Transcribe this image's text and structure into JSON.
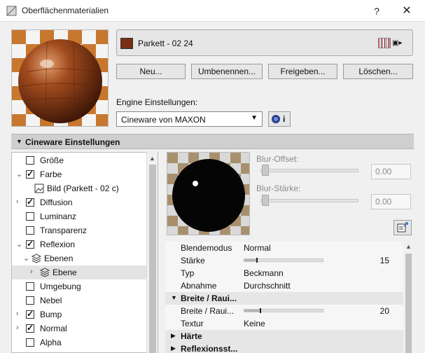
{
  "window": {
    "title": "Oberflächenmaterialien",
    "help_label": "?",
    "close_label": "✕"
  },
  "material": {
    "name": "Parkett - 02 24",
    "swatch_color": "#7a2e14",
    "extra_label": "▣▸"
  },
  "actions": {
    "new_label": "Neu...",
    "rename_label": "Umbenennen...",
    "share_label": "Freigeben...",
    "delete_label": "Löschen..."
  },
  "engine": {
    "label": "Engine Einstellungen:",
    "selected": "Cineware von MAXON",
    "info_label": "i"
  },
  "section": {
    "title": "Cineware Einstellungen"
  },
  "channels": [
    {
      "label": "Größe"
    },
    {
      "label": "Farbe"
    },
    {
      "label": "Bild (Parkett - 02 c)"
    },
    {
      "label": "Diffusion"
    },
    {
      "label": "Luminanz"
    },
    {
      "label": "Transparenz"
    },
    {
      "label": "Reflexion"
    },
    {
      "label": "Ebenen"
    },
    {
      "label": "Ebene"
    },
    {
      "label": "Umgebung"
    },
    {
      "label": "Nebel"
    },
    {
      "label": "Bump"
    },
    {
      "label": "Normal"
    },
    {
      "label": "Alpha"
    }
  ],
  "blur": {
    "offset_label": "Blur-Offset:",
    "offset_value": "0.00",
    "strength_label": "Blur-Stärke:",
    "strength_value": "0.00"
  },
  "properties": {
    "blend_mode": {
      "key": "Blendemodus",
      "value": "Normal"
    },
    "strength": {
      "key": "Stärke",
      "value": "15",
      "level": 0.15
    },
    "type": {
      "key": "Typ",
      "value": "Beckmann"
    },
    "falloff": {
      "key": "Abnahme",
      "value": "Durchschnitt"
    },
    "width_group": {
      "label": "Breite / Raui..."
    },
    "width": {
      "key": "Breite / Raui...",
      "value": "20",
      "level": 0.2
    },
    "texture": {
      "key": "Textur",
      "value": "Keine"
    },
    "hardness_group": {
      "label": "Härte"
    },
    "reflection_group": {
      "label": "Reflexionsst..."
    }
  },
  "colors": {
    "accent": "#7a2e14",
    "window_bg": "#f0f0f0",
    "highlight": "#ffffff"
  }
}
